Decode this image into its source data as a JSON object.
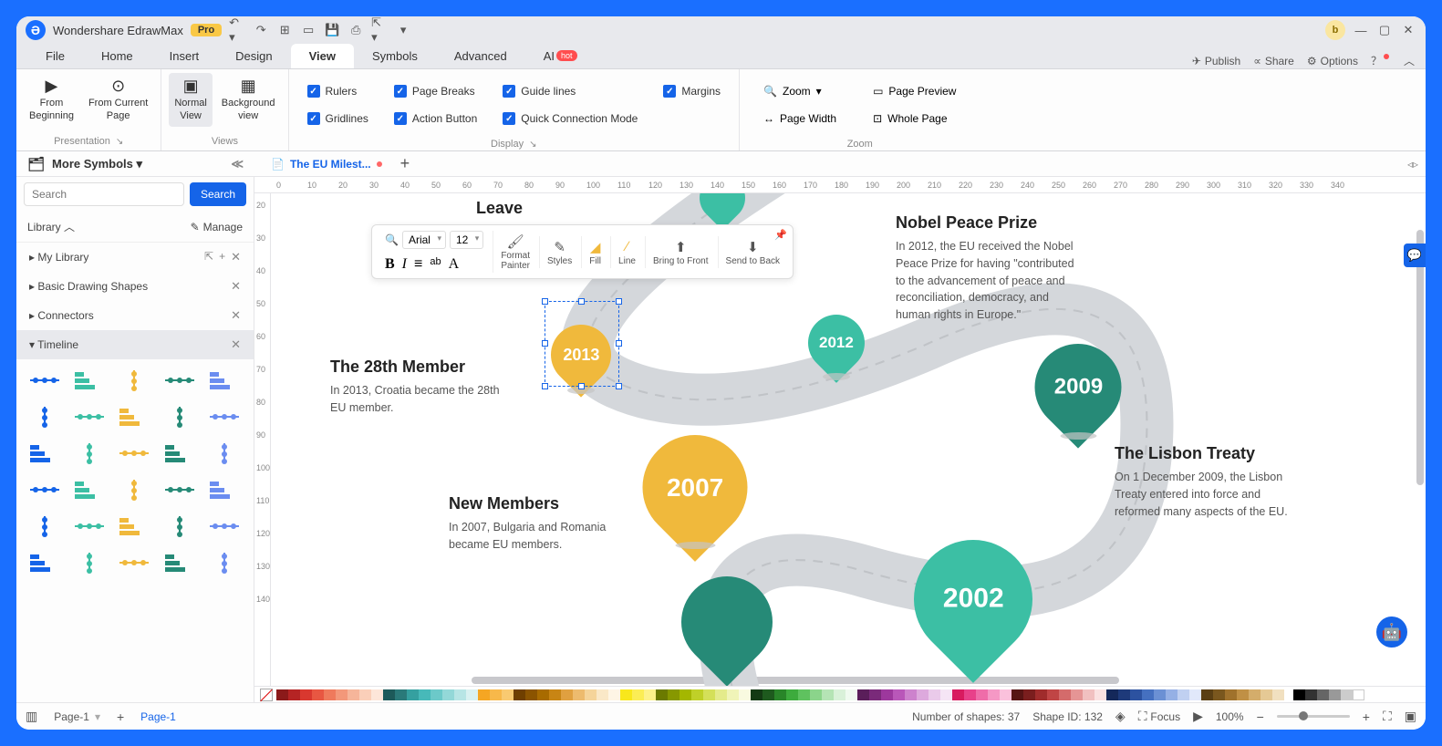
{
  "titlebar": {
    "app_name": "Wondershare EdrawMax",
    "pro": "Pro"
  },
  "menu": {
    "file": "File",
    "home": "Home",
    "insert": "Insert",
    "design": "Design",
    "view": "View",
    "symbols": "Symbols",
    "advanced": "Advanced",
    "ai": "AI",
    "hot": "hot",
    "publish": "Publish",
    "share": "Share",
    "options": "Options"
  },
  "ribbon": {
    "presentation": "Presentation",
    "from_beginning": "From\nBeginning",
    "from_current": "From Current\nPage",
    "views": "Views",
    "normal_view": "Normal\nView",
    "background_view": "Background\nview",
    "display": "Display",
    "rulers": "Rulers",
    "page_breaks": "Page Breaks",
    "guide_lines": "Guide lines",
    "margins": "Margins",
    "gridlines": "Gridlines",
    "action_button": "Action Button",
    "quick_connection": "Quick Connection Mode",
    "zoom_group": "Zoom",
    "zoom": "Zoom",
    "page_width": "Page Width",
    "page_preview": "Page Preview",
    "whole_page": "Whole Page"
  },
  "symbols_panel": {
    "more_symbols": "More Symbols",
    "search_placeholder": "Search",
    "search_btn": "Search",
    "library": "Library",
    "manage": "Manage",
    "my_library": "My Library",
    "basic_shapes": "Basic Drawing Shapes",
    "connectors": "Connectors",
    "timeline": "Timeline"
  },
  "doctab": {
    "name": "The EU Milest..."
  },
  "float_toolbar": {
    "font": "Arial",
    "size": "12",
    "format_painter": "Format\nPainter",
    "styles": "Styles",
    "fill": "Fill",
    "line": "Line",
    "bring_front": "Bring to Front",
    "send_back": "Send to Back"
  },
  "canvas": {
    "leave_title": "Leave",
    "member28_title": "The 28th Member",
    "member28_body": "In 2013, Croatia became the 28th EU member.",
    "newmembers_title": "New Members",
    "newmembers_body": "In 2007, Bulgaria and Romania became EU members.",
    "nobel_title": "Nobel Peace Prize",
    "nobel_body": "In 2012, the EU received the Nobel Peace Prize for having \"contributed to the advancement of peace and reconciliation, democracy, and human rights in Europe.\"",
    "lisbon_title": "The Lisbon Treaty",
    "lisbon_body": "On 1 December 2009, the Lisbon Treaty entered into force and reformed many aspects of the EU.",
    "pin_2013": "2013",
    "pin_2012": "2012",
    "pin_2009": "2009",
    "pin_2007": "2007",
    "pin_2002": "2002"
  },
  "statusbar": {
    "page_sel": "Page-1",
    "page_tab": "Page-1",
    "shapes": "Number of shapes: 37",
    "shape_id": "Shape ID: 132",
    "focus": "Focus",
    "zoom": "100%"
  },
  "ruler_h": [
    "0",
    "10",
    "20",
    "30",
    "40",
    "50",
    "60",
    "70",
    "80",
    "90",
    "100",
    "110",
    "120",
    "130",
    "140",
    "150",
    "160",
    "170",
    "180",
    "190",
    "200",
    "210",
    "220",
    "230",
    "240",
    "250",
    "260",
    "270",
    "280",
    "290",
    "300",
    "310",
    "320",
    "330",
    "340"
  ],
  "ruler_v": [
    "20",
    "30",
    "40",
    "50",
    "60",
    "70",
    "80",
    "90",
    "100",
    "110",
    "120",
    "130",
    "140"
  ],
  "colors": [
    "#8b1a1a",
    "#b52424",
    "#d9382f",
    "#e85742",
    "#ef7a5c",
    "#f3987a",
    "#f6b59a",
    "#facfb9",
    "#fde6d9",
    "#1d5a5a",
    "#2a7a7a",
    "#35a0a0",
    "#47b9b9",
    "#6cc9c9",
    "#93d8d8",
    "#b7e5e5",
    "#d9f1f1",
    "#f5a623",
    "#f7b84a",
    "#f9ca71",
    "#6f3f00",
    "#8b5400",
    "#a86b00",
    "#c88514",
    "#e0a040",
    "#edbb6e",
    "#f5d49a",
    "#fae8c7",
    "#fef5e5",
    "#f8e71c",
    "#fbed55",
    "#fdf28a",
    "#6b7a00",
    "#879800",
    "#a4b700",
    "#bfd028",
    "#d4e059",
    "#e4eb8b",
    "#f0f4b8",
    "#f9fae0",
    "#143a14",
    "#1e5a1e",
    "#298529",
    "#3dab3d",
    "#5fc25f",
    "#8bd48b",
    "#b5e4b5",
    "#d9f1d9",
    "#f0faf0",
    "#5a1e5a",
    "#7a2a7a",
    "#9d389d",
    "#b957b9",
    "#cd82cd",
    "#dda9dd",
    "#eacaea",
    "#f5e5f5",
    "#d81b60",
    "#e8418a",
    "#ef6da9",
    "#f598c5",
    "#fac1dc",
    "#571414",
    "#7a1e1e",
    "#a02c2c",
    "#c04545",
    "#d46b6b",
    "#e59595",
    "#f1c0c0",
    "#faE1e1",
    "#14285a",
    "#1e3a7a",
    "#2c52a0",
    "#4570c0",
    "#6b90d4",
    "#95b0e5",
    "#c0d0f1",
    "#e1e8fa",
    "#5a3f14",
    "#7a571e",
    "#a0722c",
    "#c09045",
    "#d4ad6b",
    "#e5c995",
    "#f1e0c0"
  ],
  "neutrals": [
    "#000000",
    "#333333",
    "#666666",
    "#999999",
    "#cccccc",
    "#ffffff"
  ]
}
